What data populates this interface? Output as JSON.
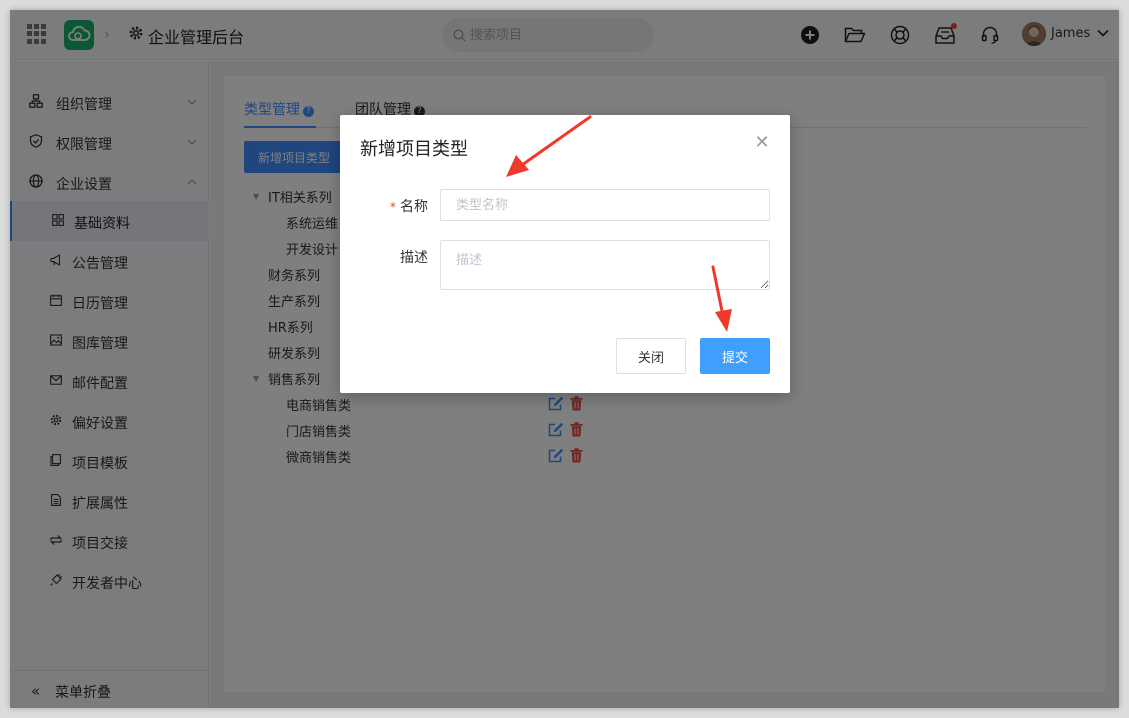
{
  "header": {
    "app_title": "企业管理后台",
    "search_placeholder": "搜索项目",
    "user_name": "James"
  },
  "sidebar": {
    "groups": [
      {
        "label": "组织管理",
        "icon": "org-chart-icon"
      },
      {
        "label": "权限管理",
        "icon": "shield-icon"
      },
      {
        "label": "企业设置",
        "icon": "globe-icon"
      }
    ],
    "items": [
      {
        "label": "基础资料",
        "icon": "grid-icon",
        "active": true
      },
      {
        "label": "公告管理",
        "icon": "megaphone-icon"
      },
      {
        "label": "日历管理",
        "icon": "calendar-icon"
      },
      {
        "label": "图库管理",
        "icon": "image-icon"
      },
      {
        "label": "邮件配置",
        "icon": "mail-icon"
      },
      {
        "label": "偏好设置",
        "icon": "gear-icon"
      },
      {
        "label": "项目模板",
        "icon": "copy-icon"
      },
      {
        "label": "扩展属性",
        "icon": "document-icon"
      },
      {
        "label": "项目交接",
        "icon": "swap-icon"
      },
      {
        "label": "开发者中心",
        "icon": "plug-icon"
      }
    ],
    "collapse_label": "菜单折叠"
  },
  "main": {
    "tabs": [
      {
        "label": "类型管理",
        "active": true
      },
      {
        "label": "团队管理",
        "active": false
      }
    ],
    "add_button_label": "新增项目类型",
    "tree": [
      {
        "label": "IT相关系列",
        "level": 0,
        "expanded": true
      },
      {
        "label": "系统运维",
        "level": 1
      },
      {
        "label": "开发设计",
        "level": 1
      },
      {
        "label": "财务系列",
        "level": 0
      },
      {
        "label": "生产系列",
        "level": 0
      },
      {
        "label": "HR系列",
        "level": 0
      },
      {
        "label": "研发系列",
        "level": 0
      },
      {
        "label": "销售系列",
        "level": 0,
        "expanded": true
      },
      {
        "label": "电商销售类",
        "level": 1
      },
      {
        "label": "门店销售类",
        "level": 1
      },
      {
        "label": "微商销售类",
        "level": 1
      }
    ]
  },
  "modal": {
    "title": "新增项目类型",
    "name_label": "名称",
    "name_required_mark": "*",
    "name_placeholder": "类型名称",
    "desc_label": "描述",
    "desc_placeholder": "描述",
    "close_button": "关闭",
    "submit_button": "提交"
  },
  "colors": {
    "primary": "#409eff",
    "tab_active": "#3f8cff",
    "danger": "#e04b4b",
    "logo_green": "#19b16a",
    "annotation_arrow": "#f0392b"
  }
}
